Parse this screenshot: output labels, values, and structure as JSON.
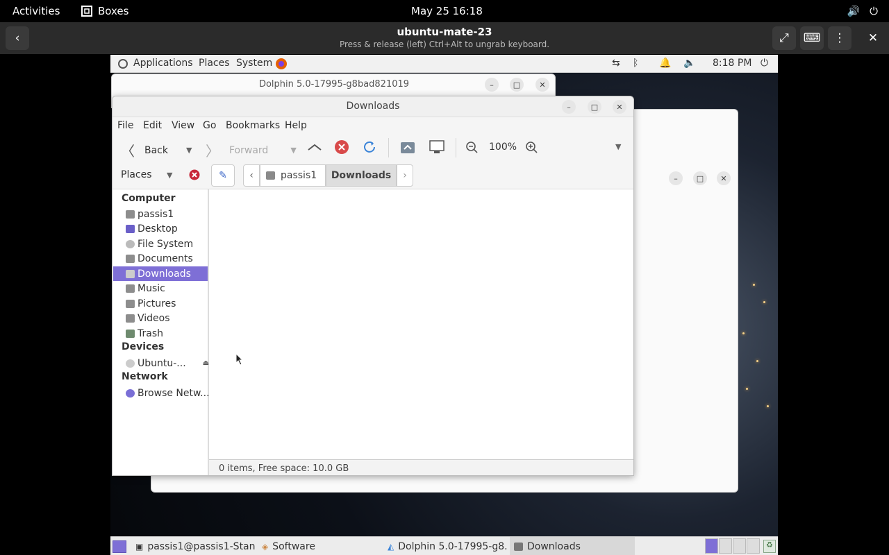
{
  "gnome_bar": {
    "activities": "Activities",
    "app_name": "Boxes",
    "clock": "May 25  16:18"
  },
  "boxes_header": {
    "title": "ubuntu-mate-23",
    "subtitle": "Press & release (left) Ctrl+Alt to ungrab keyboard."
  },
  "mate_panel": {
    "menus": [
      "Applications",
      "Places",
      "System"
    ],
    "time": "8:18 PM"
  },
  "bg_windows": {
    "dolphin_title": "Dolphin 5.0-17995-g8bad821019"
  },
  "caja": {
    "title": "Downloads",
    "menu": [
      "File",
      "Edit",
      "View",
      "Go",
      "Bookmarks",
      "Help"
    ],
    "toolbar": {
      "back": "Back",
      "forward": "Forward",
      "zoom": "100%"
    },
    "places_label": "Places",
    "path": [
      "passis1",
      "Downloads"
    ],
    "sidebar": {
      "computer_head": "Computer",
      "computer": [
        "passis1",
        "Desktop",
        "File System",
        "Documents",
        "Downloads",
        "Music",
        "Pictures",
        "Videos",
        "Trash"
      ],
      "devices_head": "Devices",
      "devices": [
        "Ubuntu-..."
      ],
      "network_head": "Network",
      "network": [
        "Browse Netw..."
      ]
    },
    "status": "0 items, Free space: 10.0 GB"
  },
  "taskbar": {
    "tasks": [
      "passis1@passis1-Stan...",
      "Software",
      "Dolphin 5.0-17995-g8...",
      "Downloads"
    ]
  },
  "colors": {
    "selection": "#7e6fd6",
    "stop": "#d84a4a",
    "reload": "#3b84d8"
  }
}
